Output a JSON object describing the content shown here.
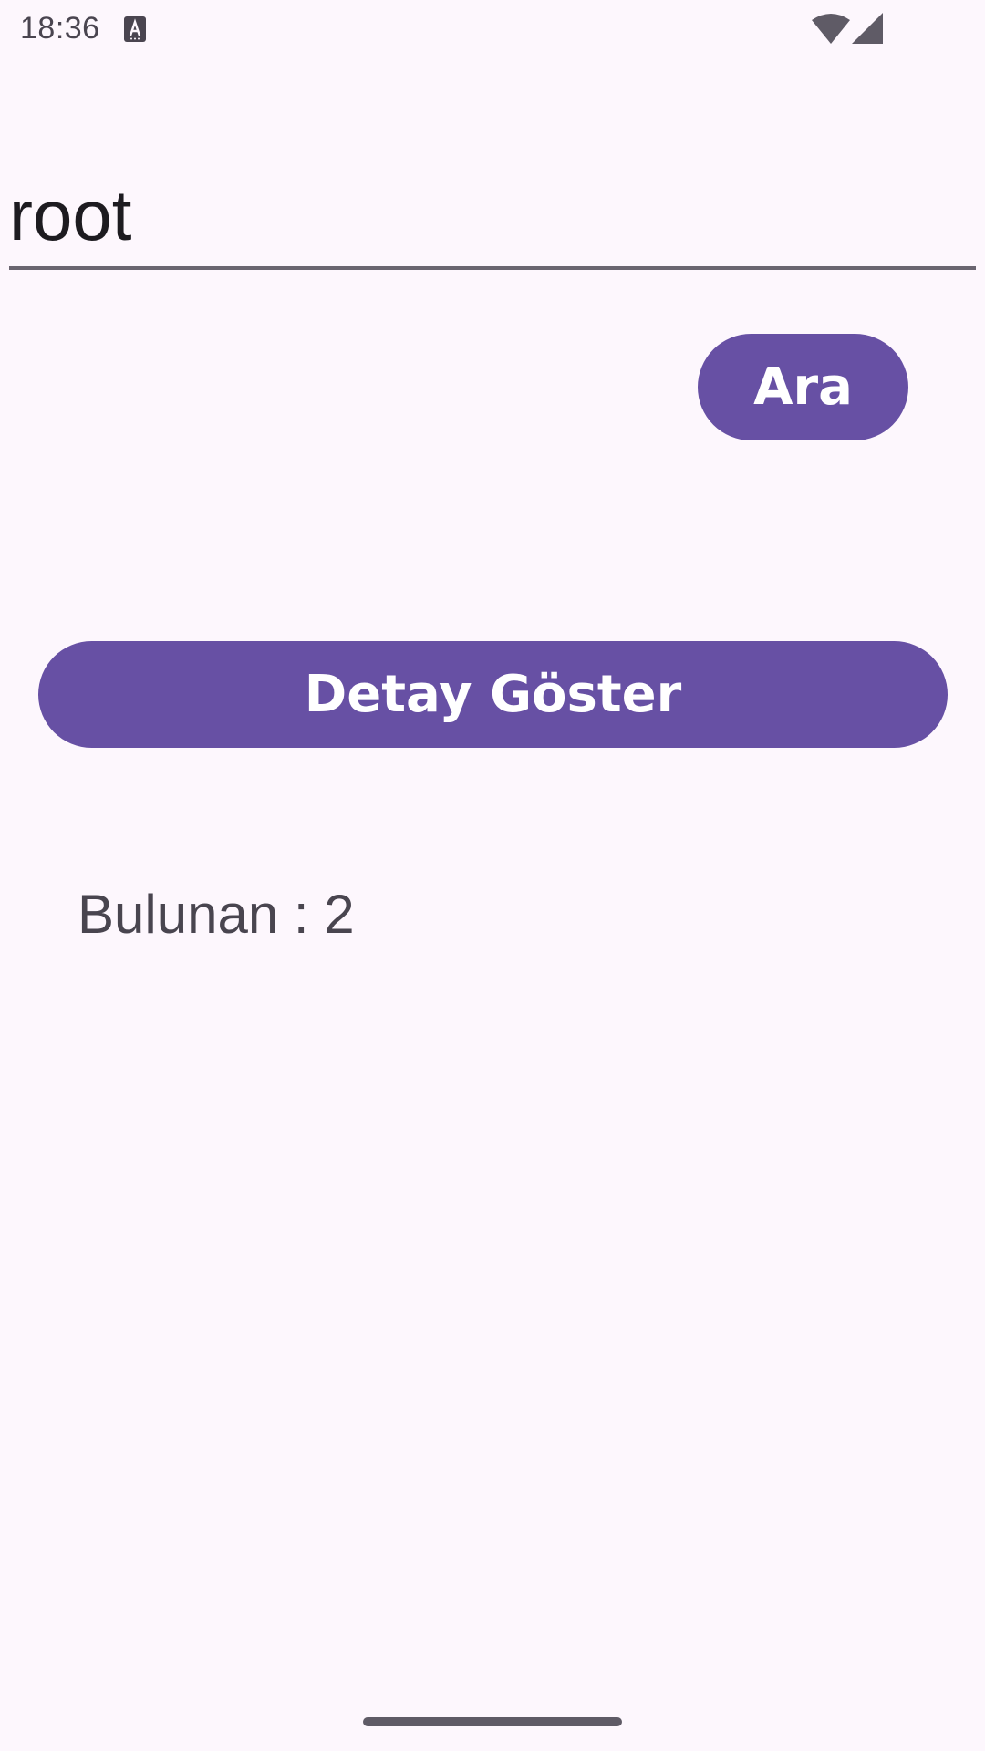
{
  "status_bar": {
    "time": "18:36",
    "icons": [
      "notification-a-icon",
      "wifi-icon",
      "signal-icon"
    ]
  },
  "search": {
    "value": "root",
    "placeholder": ""
  },
  "actions": {
    "search_label": "Ara",
    "detail_label": "Detay Göster"
  },
  "results": {
    "found_text": "Bulunan : 2"
  },
  "colors": {
    "primary": "#6750a4",
    "background": "#fdf7fd",
    "text": "#1d1b20",
    "secondary_text": "#49454f"
  }
}
